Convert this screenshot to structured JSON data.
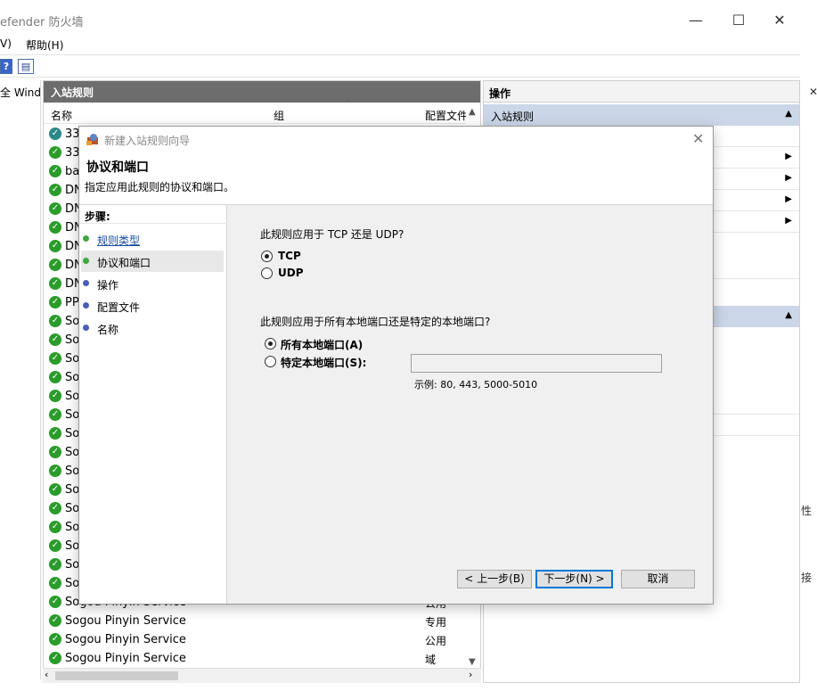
{
  "window": {
    "title": "efender 防火墙",
    "minimize": "—",
    "maximize": "☐",
    "close": "✕"
  },
  "menu": {
    "view": "V)",
    "help": "帮助(H)"
  },
  "toolbar": {
    "help_icon": "?",
    "props_icon": "▤"
  },
  "tree": {
    "item": "全 Wind"
  },
  "center": {
    "header": "入站规则",
    "columns": {
      "name": "名称",
      "group": "组",
      "profile": "配置文件"
    },
    "rows": [
      {
        "name": "33",
        "group": ""
      },
      {
        "name": "33",
        "group": ""
      },
      {
        "name": "ba",
        "group": ""
      },
      {
        "name": "DN",
        "group": ""
      },
      {
        "name": "DN",
        "group": ""
      },
      {
        "name": "DN",
        "group": ""
      },
      {
        "name": "DN",
        "group": ""
      },
      {
        "name": "DN",
        "group": ""
      },
      {
        "name": "DN",
        "group": ""
      },
      {
        "name": "PP",
        "group": ""
      },
      {
        "name": "So",
        "group": ""
      },
      {
        "name": "So",
        "group": ""
      },
      {
        "name": "So",
        "group": ""
      },
      {
        "name": "So",
        "group": ""
      },
      {
        "name": "So",
        "group": ""
      },
      {
        "name": "So",
        "group": ""
      },
      {
        "name": "So",
        "group": ""
      },
      {
        "name": "So",
        "group": ""
      },
      {
        "name": "So",
        "group": ""
      },
      {
        "name": "So",
        "group": ""
      },
      {
        "name": "So",
        "group": ""
      },
      {
        "name": "So",
        "group": ""
      },
      {
        "name": "So",
        "group": ""
      },
      {
        "name": "So",
        "group": ""
      },
      {
        "name": "So",
        "group": ""
      },
      {
        "name": "Sogou Pinyin Service",
        "group": "公用"
      },
      {
        "name": "Sogou Pinyin Service",
        "group": "专用"
      },
      {
        "name": "Sogou Pinyin Service",
        "group": "公用"
      },
      {
        "name": "Sogou Pinyin Service",
        "group": "域"
      }
    ]
  },
  "right": {
    "header": "操作",
    "section1": "入站规则",
    "far_right_1": "性",
    "far_right_2": "接"
  },
  "wizard": {
    "title": "新建入站规则向导",
    "heading": "协议和端口",
    "subtitle": "指定应用此规则的协议和端口。",
    "steps_title": "步骤:",
    "steps": [
      {
        "label": "规则类型",
        "color": "#3fa83f"
      },
      {
        "label": "协议和端口",
        "color": "#3fa83f"
      },
      {
        "label": "操作",
        "color": "#4a5dbd"
      },
      {
        "label": "配置文件",
        "color": "#4a5dbd"
      },
      {
        "label": "名称",
        "color": "#4a5dbd"
      }
    ],
    "q1": "此规则应用于 TCP 还是 UDP?",
    "tcp": "TCP",
    "udp": "UDP",
    "q2": "此规则应用于所有本地端口还是特定的本地端口?",
    "all_ports": "所有本地端口(A)",
    "specific_ports": "特定本地端口(S):",
    "port_value": "",
    "port_example": "示例: 80, 443, 5000-5010",
    "back": "< 上一步(B)",
    "next": "下一步(N) >",
    "cancel": "取消"
  }
}
